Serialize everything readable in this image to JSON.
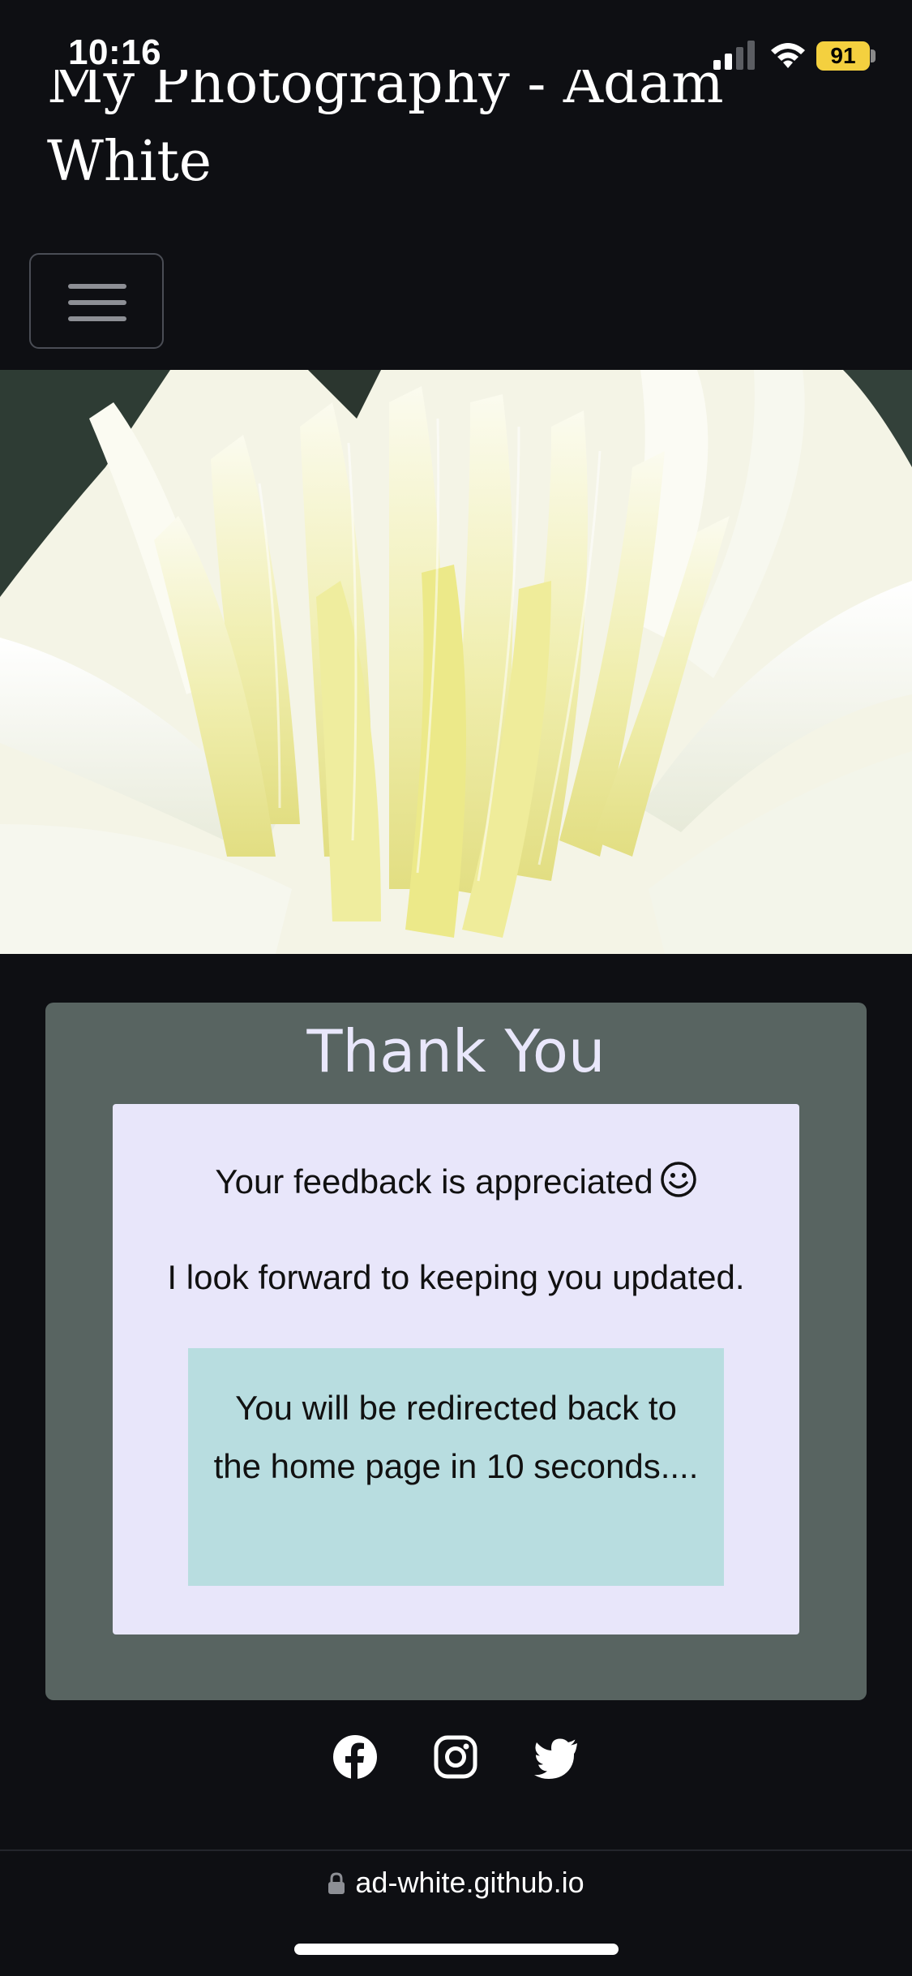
{
  "status_bar": {
    "time": "10:16",
    "battery": "91",
    "battery_color": "#f4d03f"
  },
  "header": {
    "title": "My Photography - Adam White",
    "menu_icon": "hamburger-menu-icon"
  },
  "hero": {
    "image": "white-yellow-dahlia-flower-photo"
  },
  "thank_you": {
    "heading": "Thank You",
    "feedback_text": "Your feedback is appreciated",
    "feedback_icon": "smiley-icon",
    "update_text": "I look forward to keeping you updated.",
    "redirect_text": "You will be redirected back to the home page in 10 seconds....",
    "colors": {
      "outer": "#586461",
      "inner": "#e8e6fa",
      "redirect": "#b8dde0"
    }
  },
  "social": {
    "icons": [
      "facebook-icon",
      "instagram-icon",
      "twitter-icon"
    ]
  },
  "browser": {
    "url": "ad-white.github.io",
    "lock_icon": "lock-icon"
  }
}
